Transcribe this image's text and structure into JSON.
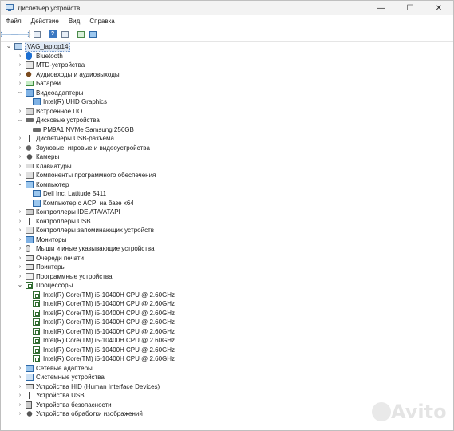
{
  "window": {
    "title": "Диспетчер устройств",
    "minimize_glyph": "—",
    "maximize_glyph": "☐",
    "close_glyph": "✕"
  },
  "menu": [
    "Файл",
    "Действие",
    "Вид",
    "Справка"
  ],
  "toolbar": [
    "back-arrow-icon",
    "forward-arrow-icon",
    "properties-icon",
    "help-icon",
    "show-hidden-icon",
    "update-driver-icon",
    "monitor-scan-icon"
  ],
  "tree": [
    {
      "label": "VAG_laptop14",
      "level": 0,
      "expanded": true,
      "icon": "root",
      "selected": true
    },
    {
      "label": "Bluetooth",
      "level": 1,
      "expanded": false,
      "icon": "bt"
    },
    {
      "label": "MTD-устройства",
      "level": 1,
      "expanded": false,
      "icon": "mtd"
    },
    {
      "label": "Аудиовходы и аудиовыходы",
      "level": 1,
      "expanded": false,
      "icon": "audio"
    },
    {
      "label": "Батареи",
      "level": 1,
      "expanded": false,
      "icon": "battery"
    },
    {
      "label": "Видеоадаптеры",
      "level": 1,
      "expanded": true,
      "icon": "video"
    },
    {
      "label": "Intel(R) UHD Graphics",
      "level": 2,
      "icon": "video"
    },
    {
      "label": "Встроенное ПО",
      "level": 1,
      "expanded": false,
      "icon": "fw"
    },
    {
      "label": "Дисковые устройства",
      "level": 1,
      "expanded": true,
      "icon": "disk"
    },
    {
      "label": "PM9A1 NVMe Samsung 256GB",
      "level": 2,
      "icon": "disk"
    },
    {
      "label": "Диспетчеры USB-разъема",
      "level": 1,
      "expanded": false,
      "icon": "usbc"
    },
    {
      "label": "Звуковые, игровые и видеоустройства",
      "level": 1,
      "expanded": false,
      "icon": "sound"
    },
    {
      "label": "Камеры",
      "level": 1,
      "expanded": false,
      "icon": "camera"
    },
    {
      "label": "Клавиатуры",
      "level": 1,
      "expanded": false,
      "icon": "keyboard"
    },
    {
      "label": "Компоненты программного обеспечения",
      "level": 1,
      "expanded": false,
      "icon": "component"
    },
    {
      "label": "Компьютер",
      "level": 1,
      "expanded": true,
      "icon": "computer"
    },
    {
      "label": "Dell Inc. Latitude 5411",
      "level": 2,
      "icon": "computer"
    },
    {
      "label": "Компьютер с ACPI на базе x64",
      "level": 2,
      "icon": "computer"
    },
    {
      "label": "Контроллеры IDE ATA/ATAPI",
      "level": 1,
      "expanded": false,
      "icon": "ide"
    },
    {
      "label": "Контроллеры USB",
      "level": 1,
      "expanded": false,
      "icon": "usb"
    },
    {
      "label": "Контроллеры запоминающих устройств",
      "level": 1,
      "expanded": false,
      "icon": "storage"
    },
    {
      "label": "Мониторы",
      "level": 1,
      "expanded": false,
      "icon": "monitor"
    },
    {
      "label": "Мыши и иные указывающие устройства",
      "level": 1,
      "expanded": false,
      "icon": "mouse"
    },
    {
      "label": "Очереди печати",
      "level": 1,
      "expanded": false,
      "icon": "print"
    },
    {
      "label": "Принтеры",
      "level": 1,
      "expanded": false,
      "icon": "print"
    },
    {
      "label": "Программные устройства",
      "level": 1,
      "expanded": false,
      "icon": "software"
    },
    {
      "label": "Процессоры",
      "level": 1,
      "expanded": true,
      "icon": "cpu"
    },
    {
      "label": "Intel(R) Core(TM) i5-10400H CPU @ 2.60GHz",
      "level": 2,
      "icon": "cpu"
    },
    {
      "label": "Intel(R) Core(TM) i5-10400H CPU @ 2.60GHz",
      "level": 2,
      "icon": "cpu"
    },
    {
      "label": "Intel(R) Core(TM) i5-10400H CPU @ 2.60GHz",
      "level": 2,
      "icon": "cpu"
    },
    {
      "label": "Intel(R) Core(TM) i5-10400H CPU @ 2.60GHz",
      "level": 2,
      "icon": "cpu"
    },
    {
      "label": "Intel(R) Core(TM) i5-10400H CPU @ 2.60GHz",
      "level": 2,
      "icon": "cpu"
    },
    {
      "label": "Intel(R) Core(TM) i5-10400H CPU @ 2.60GHz",
      "level": 2,
      "icon": "cpu"
    },
    {
      "label": "Intel(R) Core(TM) i5-10400H CPU @ 2.60GHz",
      "level": 2,
      "icon": "cpu"
    },
    {
      "label": "Intel(R) Core(TM) i5-10400H CPU @ 2.60GHz",
      "level": 2,
      "icon": "cpu"
    },
    {
      "label": "Сетевые адаптеры",
      "level": 1,
      "expanded": false,
      "icon": "net"
    },
    {
      "label": "Системные устройства",
      "level": 1,
      "expanded": false,
      "icon": "sys"
    },
    {
      "label": "Устройства HID (Human Interface Devices)",
      "level": 1,
      "expanded": false,
      "icon": "hid"
    },
    {
      "label": "Устройства USB",
      "level": 1,
      "expanded": false,
      "icon": "usb"
    },
    {
      "label": "Устройства безопасности",
      "level": 1,
      "expanded": false,
      "icon": "security"
    },
    {
      "label": "Устройства обработки изображений",
      "level": 1,
      "expanded": false,
      "icon": "imaging"
    }
  ],
  "watermark": {
    "text": "Avito"
  }
}
